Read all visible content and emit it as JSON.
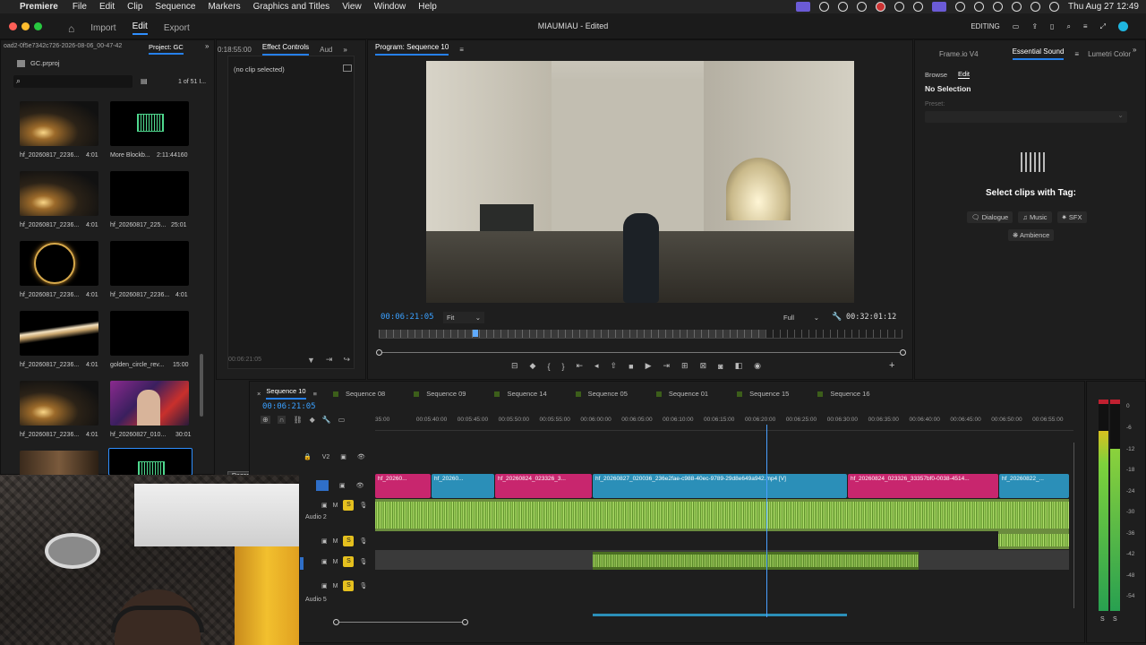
{
  "menubar": {
    "app": "Premiere",
    "items": [
      "File",
      "Edit",
      "Clip",
      "Sequence",
      "Markers",
      "Graphics and Titles",
      "View",
      "Window",
      "Help"
    ],
    "datetime": "Thu Aug 27  12:49"
  },
  "titlebar": {
    "nav": {
      "import": "Import",
      "edit": "Edit",
      "export": "Export"
    },
    "title": "MIAUMIAU - Edited",
    "workspace": "EDITING"
  },
  "project": {
    "path": "oad2-0f5e7342c726-2026-08-06_00-47-42",
    "tab": "Project: GC",
    "file": "GC.prproj",
    "count": "1 of 51 I...",
    "items": [
      {
        "label": "hf_20260817_2236...",
        "dur": "4:01"
      },
      {
        "label": "More Blockb...",
        "dur": "2:11:44160"
      },
      {
        "label": "hf_20260817_2236...",
        "dur": "4:01"
      },
      {
        "label": "hf_20260817_225...",
        "dur": "25:01"
      },
      {
        "label": "hf_20260817_2236...",
        "dur": "4:01"
      },
      {
        "label": "hf_20260817_2236...",
        "dur": "4:01"
      },
      {
        "label": "hf_20260817_2236...",
        "dur": "4:01"
      },
      {
        "label": "golden_circle_rev...",
        "dur": "15:00"
      },
      {
        "label": "hf_20260817_2236...",
        "dur": "4:01"
      },
      {
        "label": "hf_20260827_010...",
        "dur": "30:01"
      }
    ]
  },
  "effects": {
    "timecode_tab": "0:18:55:00",
    "tab": "Effect Controls",
    "tab2": "Aud",
    "noclip": "(no clip selected)",
    "foot_tc": "00:06:21:05"
  },
  "program": {
    "tab": "Program: Sequence 10",
    "timecode": "00:06:21:05",
    "fit": "Fit",
    "full": "Full",
    "duration": "00:32:01:12",
    "playhead": 0.18
  },
  "right": {
    "tabs": {
      "frameio": "Frame.io V4",
      "essential": "Essential Sound",
      "lumetri": "Lumetri Color"
    },
    "browse": "Browse",
    "edit": "Edit",
    "nosel": "No Selection",
    "preset": "Preset:",
    "heading": "Select clips with Tag:",
    "tags": {
      "dialogue": "Dialogue",
      "music": "Music",
      "sfx": "SFX",
      "ambience": "Ambience"
    }
  },
  "timeline": {
    "timecode": "00:06:21:05",
    "tabs": [
      "Sequence 10",
      "Sequence 08",
      "Sequence 09",
      "Sequence 14",
      "Sequence 05",
      "Sequence 01",
      "Sequence 15",
      "Sequence 16"
    ],
    "ruler": [
      "35:00",
      "00:05:40:00",
      "00:05:45:00",
      "00:05:50:00",
      "00:05:55:00",
      "00:06:00:00",
      "00:06:05:00",
      "00:06:10:00",
      "00:06:15:00",
      "00:06:20:00",
      "00:06:25:00",
      "00:06:30:00",
      "00:06:35:00",
      "00:06:40:00",
      "00:06:45:00",
      "00:06:50:00",
      "00:06:55:00"
    ],
    "track_v2": "V2",
    "track_a2": "Audio 2",
    "track_a5": "Audio 5",
    "m": "M",
    "s": "S",
    "clips": [
      "hf_20260...",
      "hf_20260...",
      "hf_20260824_023326_3...",
      "hf_20260827_020036_236e2fae-c988-40ec-9789-29d8e649a942.mp4 [V]",
      "hf_20260824_023326_33357bf0-0038-4514...",
      "hf_20260822_..."
    ],
    "tooltip": "Razor Tool (C)"
  },
  "meter": {
    "labels": [
      "0",
      "-6",
      "-12",
      "-18",
      "-24",
      "-30",
      "-36",
      "-42",
      "-48",
      "-54"
    ],
    "sl": "S",
    "sr": "S"
  }
}
